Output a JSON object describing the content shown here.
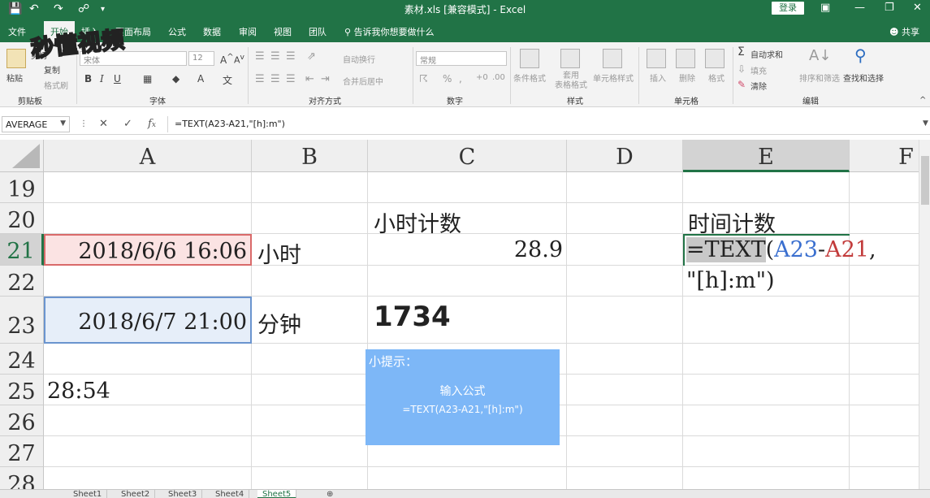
{
  "titlebar": {
    "title": "素材.xls  [兼容模式]  -  Excel",
    "login": "登录"
  },
  "menu": {
    "tabs": [
      "文件",
      "开始",
      "插入",
      "页面布局",
      "公式",
      "数据",
      "审阅",
      "视图",
      "团队"
    ],
    "tell_me": "告诉我你想要做什么",
    "share": "共享"
  },
  "watermark": {
    "text": "秒懂视频"
  },
  "ribbon": {
    "groups": [
      "剪贴板",
      "字体",
      "对齐方式",
      "数字",
      "样式",
      "单元格",
      "编辑"
    ],
    "clipboard": {
      "paste": "粘贴",
      "cut": "剪切",
      "copy": "复制",
      "format_painter": "格式刷"
    },
    "font": {
      "name": "宋体",
      "size": "12"
    },
    "alignment": {
      "wrap": "自动换行",
      "merge": "合并后居中"
    },
    "number": {
      "format": "常规"
    },
    "styles": {
      "conditional": "条件格式",
      "table": "套用\n表格格式",
      "cell_styles": "单元格样式"
    },
    "cells": {
      "insert": "插入",
      "delete": "删除",
      "format": "格式"
    },
    "editing": {
      "autosum": "自动求和",
      "fill": "填充",
      "clear": "清除",
      "sort": "排序和筛选",
      "find": "查找和选择"
    }
  },
  "formula_bar": {
    "name_box": "AVERAGE",
    "formula": "=TEXT(A23-A21,\"[h]:m\")"
  },
  "columns": [
    "A",
    "B",
    "C",
    "D",
    "E",
    "F"
  ],
  "rows": [
    "19",
    "20",
    "21",
    "22",
    "23",
    "24",
    "25",
    "26",
    "27",
    "28"
  ],
  "cells": {
    "C20": "小时计数",
    "E20": "时间计数",
    "A21": "2018/6/6 16:06",
    "B21": "小时",
    "C21": "28.9",
    "A23": "2018/6/7 21:00",
    "B23": "分钟",
    "C23": "1734",
    "A25": "28:54"
  },
  "editing_cell": {
    "fn": "=TEXT",
    "paren": "(",
    "ref1": "A23",
    "minus": "-",
    "ref2": "A21",
    "comma": ",",
    "line2": "\"[h]:m\")"
  },
  "tip": {
    "title": "小提示：",
    "line1": "输入公式",
    "line2": "=TEXT(A23-A21,\"[h]:m\")"
  },
  "sheets": [
    "Sheet1",
    "Sheet2",
    "Sheet3",
    "Sheet4",
    "Sheet5"
  ],
  "active_sheet": "Sheet5",
  "colors": {
    "excel_green": "#217346",
    "tip_blue": "#7db7f7",
    "ref_blue": "#3a6fcf",
    "ref_red": "#c23b3b"
  }
}
